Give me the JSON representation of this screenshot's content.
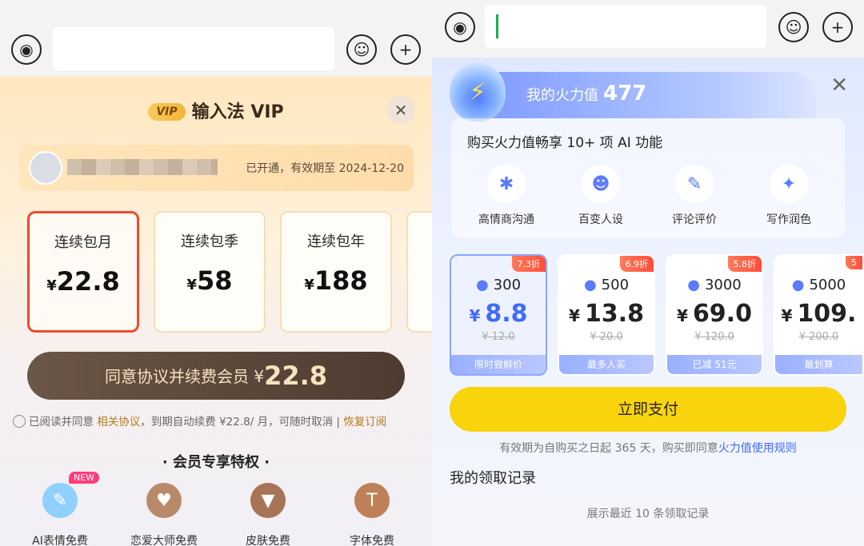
{
  "left": {
    "vip_badge": "VIP",
    "title": "输入法 VIP",
    "close_glyph": "✕",
    "user": {
      "valid_text": "已开通，有效期至 2024-12-20"
    },
    "plans": [
      {
        "name": "连续包月",
        "currency": "¥",
        "price": "22.8",
        "selected": true
      },
      {
        "name": "连续包季",
        "currency": "¥",
        "price": "58"
      },
      {
        "name": "连续包年",
        "currency": "¥",
        "price": "188"
      }
    ],
    "renew_button": {
      "label": "同意协议并续费会员",
      "currency": "¥",
      "amount": "22.8"
    },
    "agreement": {
      "prefix": "已阅读并同意",
      "link": "相关协议",
      "middle": "，到期自动续费 ¥22.8/ 月，可随时取消 |",
      "restore": "恢复订阅"
    },
    "perks_title": "· 会员专享特权 ·",
    "new_tag": "NEW",
    "perks": [
      {
        "label": "AI表情免费",
        "icon": "emoji-pen-icon",
        "color": "#7fc8ff"
      },
      {
        "label": "恋爱大师免费",
        "icon": "heart-icon",
        "color": "#b07a5a"
      },
      {
        "label": "皮肤免费",
        "icon": "shirt-icon",
        "color": "#a06a4a"
      },
      {
        "label": "字体免费",
        "icon": "font-icon",
        "color": "#b67950"
      }
    ]
  },
  "right": {
    "fire_label": "我的火力值",
    "fire_count": "477",
    "close_glyph": "✕",
    "ai_title": "购买火力值畅享 10+ 项 AI 功能",
    "features": [
      {
        "label": "高情商沟通",
        "icon": "chat-star-icon"
      },
      {
        "label": "百变人设",
        "icon": "robot-face-icon"
      },
      {
        "label": "评论评价",
        "icon": "edit-note-icon"
      },
      {
        "label": "写作润色",
        "icon": "magic-wand-icon"
      }
    ],
    "packages": [
      {
        "points": "300",
        "currency": "¥",
        "price": "8.8",
        "original": "¥ 12.0",
        "discount": "7.3折",
        "footer": "限时尝鲜价",
        "selected": true
      },
      {
        "points": "500",
        "currency": "¥",
        "price": "13.8",
        "original": "¥ 20.0",
        "discount": "6.9折",
        "footer": "最多人买"
      },
      {
        "points": "3000",
        "currency": "¥",
        "price": "69.0",
        "original": "¥ 120.0",
        "discount": "5.8折",
        "footer": "已减 51元"
      },
      {
        "points": "5000",
        "currency": "¥",
        "price": "109.",
        "original": "¥ 200.0",
        "discount": "5",
        "footer": "最划算"
      }
    ],
    "pay_button": "立即支付",
    "valid_note_prefix": "有效期为自购买之日起 365 天，购买即同意",
    "valid_note_link": "火力值使用规则",
    "record_title": "我的领取记录",
    "record_note": "展示最近 10 条领取记录"
  },
  "colors": {
    "accent_red": "#ef4a2d",
    "pay_yellow": "#f9d30c",
    "blue": "#3f6bff"
  }
}
